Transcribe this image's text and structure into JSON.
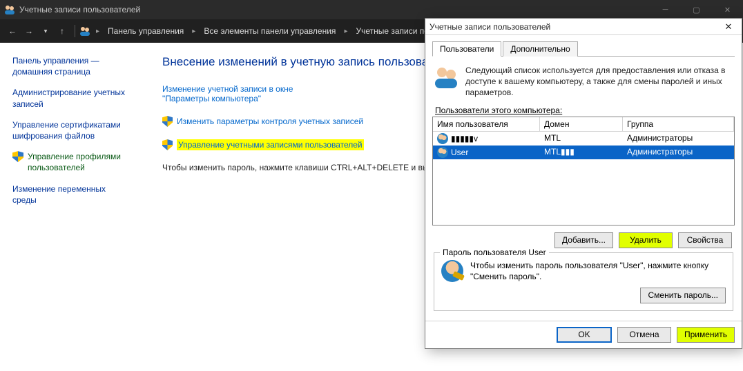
{
  "titlebar": {
    "title": "Учетные записи пользователей"
  },
  "breadcrumb": {
    "a": "Панель управления",
    "b": "Все элементы панели управления",
    "c": "Учетные записи польз..."
  },
  "sidebar": {
    "home1": "Панель управления —",
    "home2": "домашняя страница",
    "s1a": "Администрирование учетных",
    "s1b": "записей",
    "s2a": "Управление сертификатами",
    "s2b": "шифрования файлов",
    "s3a": "Управление профилями",
    "s3b": "пользователей",
    "s4a": "Изменение переменных",
    "s4b": "среды"
  },
  "main": {
    "heading": "Внесение изменений в учетную запись пользователя",
    "link1a": "Изменение учетной записи в окне",
    "link1b": "\"Параметры компьютера\"",
    "link2": "Изменить параметры контроля учетных записей",
    "link3": "Управление учетными записями пользователей",
    "tip": "Чтобы изменить пароль, нажмите клавиши CTRL+ALT+DELETE и выбе"
  },
  "dialog": {
    "title": "Учетные записи пользователей",
    "tab_users": "Пользователи",
    "tab_more": "Дополнительно",
    "intro": "Следующий список используется для предоставления или отказа в доступе к вашему компьютеру, а также для смены паролей и иных параметров.",
    "list_label": "Пользователи этого компьютера:",
    "col_user": "Имя пользователя",
    "col_domain": "Домен",
    "col_group": "Группа",
    "rows": [
      {
        "name": "▮▮▮▮▮v",
        "domain": "MTL",
        "group": "Администраторы"
      },
      {
        "name": "User",
        "domain": "MTL▮▮▮",
        "group": "Администраторы"
      }
    ],
    "btn_add": "Добавить...",
    "btn_del": "Удалить",
    "btn_props": "Свойства",
    "group_legend": "Пароль пользователя User",
    "group_text": "Чтобы изменить пароль пользователя \"User\", нажмите кнопку \"Сменить пароль\".",
    "btn_changepw": "Сменить пароль...",
    "btn_ok": "OK",
    "btn_cancel": "Отмена",
    "btn_apply": "Применить"
  }
}
